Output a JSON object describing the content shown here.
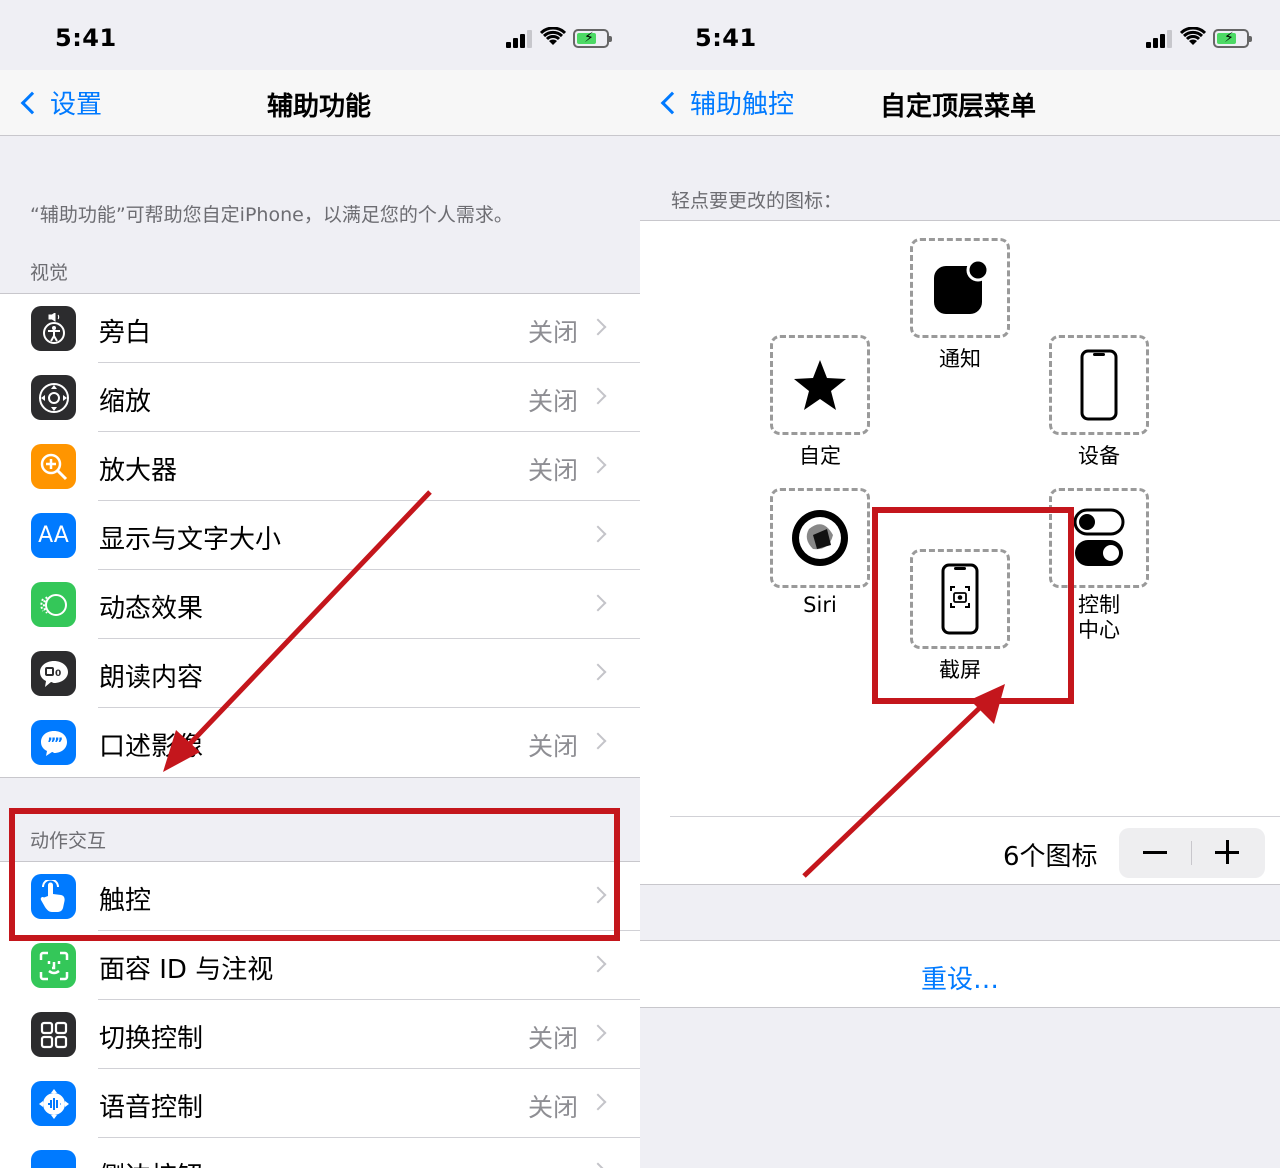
{
  "left": {
    "status": {
      "time": "5:41"
    },
    "nav": {
      "back": "设置",
      "title": "辅助功能"
    },
    "description": "“辅助功能”可帮助您自定iPhone，以满足您的个人需求。",
    "vision": {
      "header": "视觉",
      "rows": [
        {
          "label": "旁白",
          "value": "关闭",
          "icon": "voiceover-icon",
          "color": "#2c2c2e"
        },
        {
          "label": "缩放",
          "value": "关闭",
          "icon": "zoom-icon",
          "color": "#2c2c2e"
        },
        {
          "label": "放大器",
          "value": "关闭",
          "icon": "magnifier-icon",
          "color": "#ff9500"
        },
        {
          "label": "显示与文字大小",
          "value": "",
          "icon": "text-size-icon",
          "color": "#007aff"
        },
        {
          "label": "动态效果",
          "value": "",
          "icon": "motion-icon",
          "color": "#34c759"
        },
        {
          "label": "朗读内容",
          "value": "",
          "icon": "spoken-content-icon",
          "color": "#2c2c2e"
        },
        {
          "label": "口述影像",
          "value": "关闭",
          "icon": "audio-description-icon",
          "color": "#007aff"
        }
      ]
    },
    "interaction": {
      "header": "动作交互",
      "rows": [
        {
          "label": "触控",
          "value": "",
          "icon": "touch-icon",
          "color": "#007aff"
        },
        {
          "label": "面容 ID 与注视",
          "value": "",
          "icon": "face-id-icon",
          "color": "#34c759"
        },
        {
          "label": "切换控制",
          "value": "关闭",
          "icon": "switch-control-icon",
          "color": "#2c2c2e"
        },
        {
          "label": "语音控制",
          "value": "关闭",
          "icon": "voice-control-icon",
          "color": "#007aff"
        },
        {
          "label": "侧边按钮",
          "value": "",
          "icon": "side-button-icon",
          "color": "#007aff"
        }
      ]
    }
  },
  "right": {
    "status": {
      "time": "5:41"
    },
    "nav": {
      "back": "辅助触控",
      "title": "自定顶层菜单"
    },
    "tap_header": "轻点要更改的图标：",
    "slots": {
      "notification": "通知",
      "custom": "自定",
      "device": "设备",
      "siri": "Siri",
      "screenshot": "截屏",
      "control_center": "控制\n中心"
    },
    "count_label": "6个图标",
    "reset": "重设…"
  },
  "colors": {
    "accent": "#007aff",
    "annotation_red": "#c4161c"
  }
}
